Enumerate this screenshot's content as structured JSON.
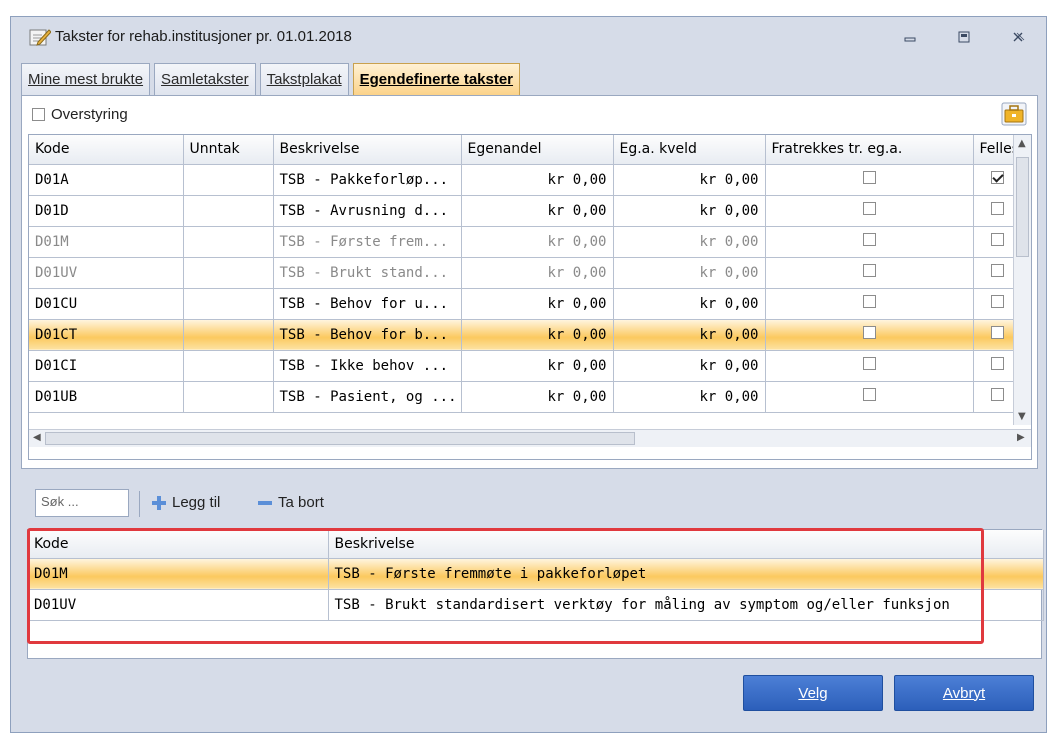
{
  "window": {
    "title": "Takster for rehab.institusjoner pr. 01.01.2018",
    "icons": {
      "app": "edit-pencil-icon",
      "minimize": "minimize-icon",
      "restore": "restore-icon",
      "close": "close-icon"
    }
  },
  "tabs": [
    {
      "label": "Mine mest brukte",
      "active": false
    },
    {
      "label": "Samletakster",
      "active": false
    },
    {
      "label": "Takstplakat",
      "active": false
    },
    {
      "label": "Egendefinerte takster",
      "active": true
    }
  ],
  "override": {
    "label": "Overstyring",
    "checked": false
  },
  "grid": {
    "columns": [
      "Kode",
      "Unntak",
      "Beskrivelse",
      "Egenandel",
      "Eg.a. kveld",
      "Fratrekkes tr. eg.a.",
      "Felles"
    ],
    "rows": [
      {
        "kode": "D01A",
        "unntak": "",
        "beskrivelse": "TSB - Pakkeforløp...",
        "egenandel": "kr 0,00",
        "kveld": "kr 0,00",
        "fratrekkes": false,
        "felles": true,
        "dim": false,
        "selected": false
      },
      {
        "kode": "D01D",
        "unntak": "",
        "beskrivelse": "TSB - Avrusning d...",
        "egenandel": "kr 0,00",
        "kveld": "kr 0,00",
        "fratrekkes": false,
        "felles": false,
        "dim": false,
        "selected": false
      },
      {
        "kode": "D01M",
        "unntak": "",
        "beskrivelse": "TSB - Første frem...",
        "egenandel": "kr 0,00",
        "kveld": "kr 0,00",
        "fratrekkes": false,
        "felles": false,
        "dim": true,
        "selected": false
      },
      {
        "kode": "D01UV",
        "unntak": "",
        "beskrivelse": "TSB - Brukt stand...",
        "egenandel": "kr 0,00",
        "kveld": "kr 0,00",
        "fratrekkes": false,
        "felles": false,
        "dim": true,
        "selected": false
      },
      {
        "kode": "D01CU",
        "unntak": "",
        "beskrivelse": "TSB - Behov for u...",
        "egenandel": "kr 0,00",
        "kveld": "kr 0,00",
        "fratrekkes": false,
        "felles": false,
        "dim": false,
        "selected": false
      },
      {
        "kode": "D01CT",
        "unntak": "",
        "beskrivelse": "TSB - Behov for b...",
        "egenandel": "kr 0,00",
        "kveld": "kr 0,00",
        "fratrekkes": false,
        "felles": false,
        "dim": false,
        "selected": true
      },
      {
        "kode": "D01CI",
        "unntak": "",
        "beskrivelse": "TSB - Ikke behov ...",
        "egenandel": "kr 0,00",
        "kveld": "kr 0,00",
        "fratrekkes": false,
        "felles": false,
        "dim": false,
        "selected": false
      },
      {
        "kode": "D01UB",
        "unntak": "",
        "beskrivelse": "TSB - Pasient, og ...",
        "egenandel": "kr 0,00",
        "kveld": "kr 0,00",
        "fratrekkes": false,
        "felles": false,
        "dim": false,
        "selected": false
      }
    ]
  },
  "toolbar": {
    "search_placeholder": "Søk ...",
    "add_label": "Legg til",
    "remove_label": "Ta bort"
  },
  "list": {
    "columns": [
      "Kode",
      "Beskrivelse"
    ],
    "rows": [
      {
        "kode": "D01M",
        "beskrivelse": "TSB - Første fremmøte i pakkeforløpet",
        "selected": true
      },
      {
        "kode": "D01UV",
        "beskrivelse": "TSB - Brukt standardisert verktøy for måling av symptom og/eller funksjon",
        "selected": false
      }
    ]
  },
  "buttons": {
    "select": "Velg",
    "cancel": "Avbryt"
  },
  "colors": {
    "selection": "#fbc95f",
    "accent_button": "#2c5fba",
    "highlight_border": "#e0393e"
  }
}
